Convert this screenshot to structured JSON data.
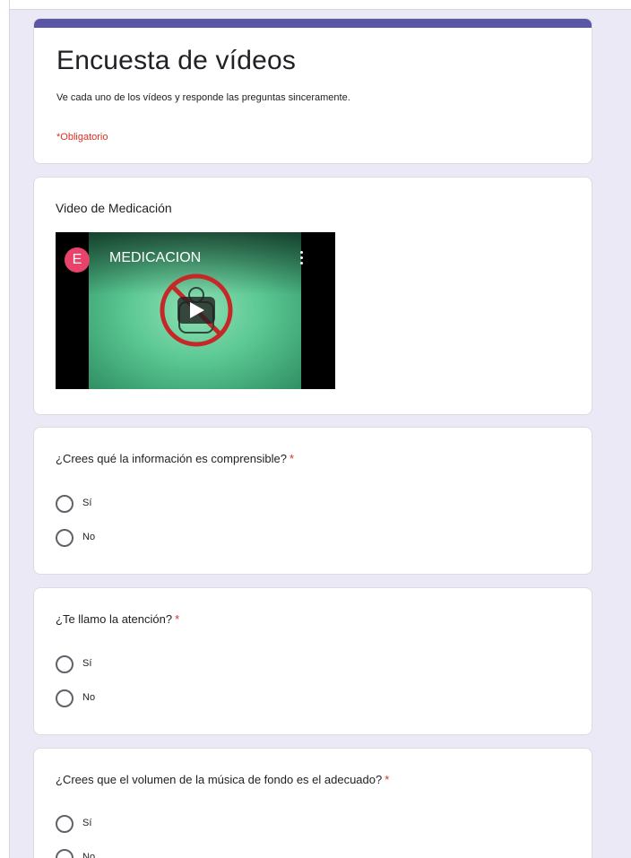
{
  "form": {
    "title": "Encuesta de vídeos",
    "description": "Ve cada uno de los vídeos y responde las preguntas sinceramente.",
    "required_note": "*Obligatorio",
    "accent_color": "#5c56a6"
  },
  "video_section": {
    "title": "Video de Medicación",
    "video": {
      "channel_initial": "E",
      "name": "MEDICACION",
      "avatar_color": "#e8436b",
      "icons": [
        "play-icon",
        "more-vert-icon"
      ]
    }
  },
  "questions": [
    {
      "text": "¿Crees qué la información es comprensible?",
      "required_mark": "*",
      "options": [
        "Sí",
        "No"
      ]
    },
    {
      "text": "¿Te llamo la atención?",
      "required_mark": "*",
      "options": [
        "Sí",
        "No"
      ]
    },
    {
      "text": "¿Crees que el volumen de la música de fondo es el adecuado?",
      "required_mark": "*",
      "options": [
        "Sí",
        "No"
      ]
    }
  ]
}
